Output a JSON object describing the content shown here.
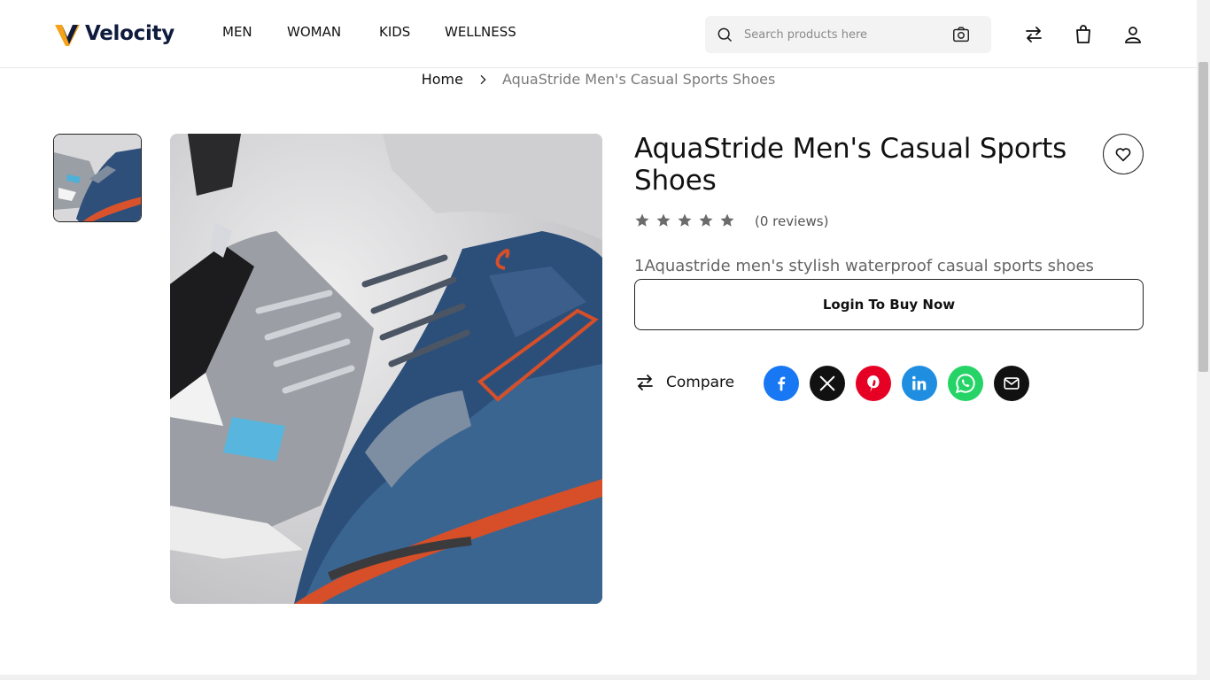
{
  "header": {
    "brand": "Velocity",
    "nav": [
      "MEN",
      "WOMAN",
      "KIDS",
      "WELLNESS"
    ],
    "search_placeholder": "Search products here",
    "icons": [
      "search-icon",
      "camera-icon",
      "compare-arrows-icon",
      "shopping-bag-icon",
      "user-icon"
    ]
  },
  "breadcrumb": {
    "home": "Home",
    "current": "AquaStride Men's Casual Sports Shoes"
  },
  "product": {
    "title": "AquaStride Men's Casual Sports Shoes",
    "rating_stars": 0,
    "rating_max": 5,
    "reviews_label": "(0 reviews)",
    "description": "1Aquastride men's stylish waterproof casual sports shoes",
    "buy_label": "Login To Buy Now",
    "compare_label": "Compare"
  },
  "share": [
    "facebook-icon",
    "x-icon",
    "pinterest-icon",
    "linkedin-icon",
    "whatsapp-icon",
    "email-icon"
  ],
  "colors": {
    "facebook": "#1877f2",
    "x": "#111111",
    "pinterest": "#e60023",
    "linkedin": "#1f8ee0",
    "whatsapp": "#25d366",
    "email": "#111111",
    "brand_navy": "#0f1b3d",
    "brand_orange": "#f6a21a"
  }
}
